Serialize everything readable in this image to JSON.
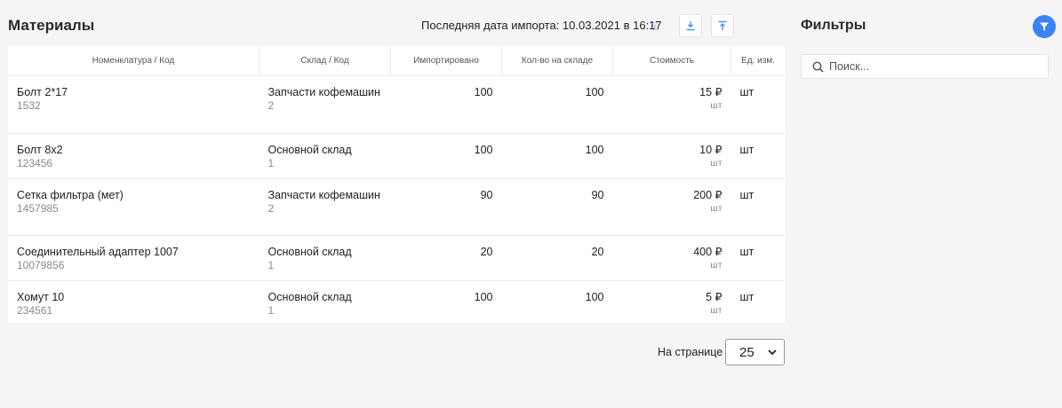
{
  "header": {
    "title": "Материалы",
    "import_info": "Последняя дата импорта: 10.03.2021 в 16:17",
    "icons": [
      "info-icon",
      "download-icon",
      "upload-icon"
    ]
  },
  "table": {
    "columns": [
      "Номенклатура / Код",
      "Склад / Код",
      "Импортировано",
      "Кол-во на складе",
      "Стоимость",
      "Ед. изм."
    ],
    "rows": [
      {
        "name": "Болт 2*17",
        "code": "1532",
        "warehouse": "Запчасти кофемашин",
        "warehouse_code": "2",
        "imported": "100",
        "qty": "100",
        "cost": "15 ₽",
        "cost_unit": "шт",
        "unit": "шт"
      },
      {
        "name": "Болт 8х2",
        "code": "123456",
        "warehouse": "Основной склад",
        "warehouse_code": "1",
        "imported": "100",
        "qty": "100",
        "cost": "10 ₽",
        "cost_unit": "шт",
        "unit": "шт"
      },
      {
        "name": "Сетка фильтра (мет)",
        "code": "1457985",
        "warehouse": "Запчасти кофемашин",
        "warehouse_code": "2",
        "imported": "90",
        "qty": "90",
        "cost": "200 ₽",
        "cost_unit": "шт",
        "unit": "шт"
      },
      {
        "name": "Соединительный адаптер 1007",
        "code": "10079856",
        "warehouse": "Основной склад",
        "warehouse_code": "1",
        "imported": "20",
        "qty": "20",
        "cost": "400 ₽",
        "cost_unit": "шт",
        "unit": "шт"
      },
      {
        "name": "Хомут 10",
        "code": "234561",
        "warehouse": "Основной склад",
        "warehouse_code": "1",
        "imported": "100",
        "qty": "100",
        "cost": "5 ₽",
        "cost_unit": "шт",
        "unit": "шт"
      }
    ]
  },
  "pagination": {
    "label": "На странице",
    "per_page": "25"
  },
  "filters": {
    "title": "Фильтры",
    "search_placeholder": "Поиск..."
  },
  "colors": {
    "accent": "#3b82f6",
    "background": "#f5f5f5"
  }
}
